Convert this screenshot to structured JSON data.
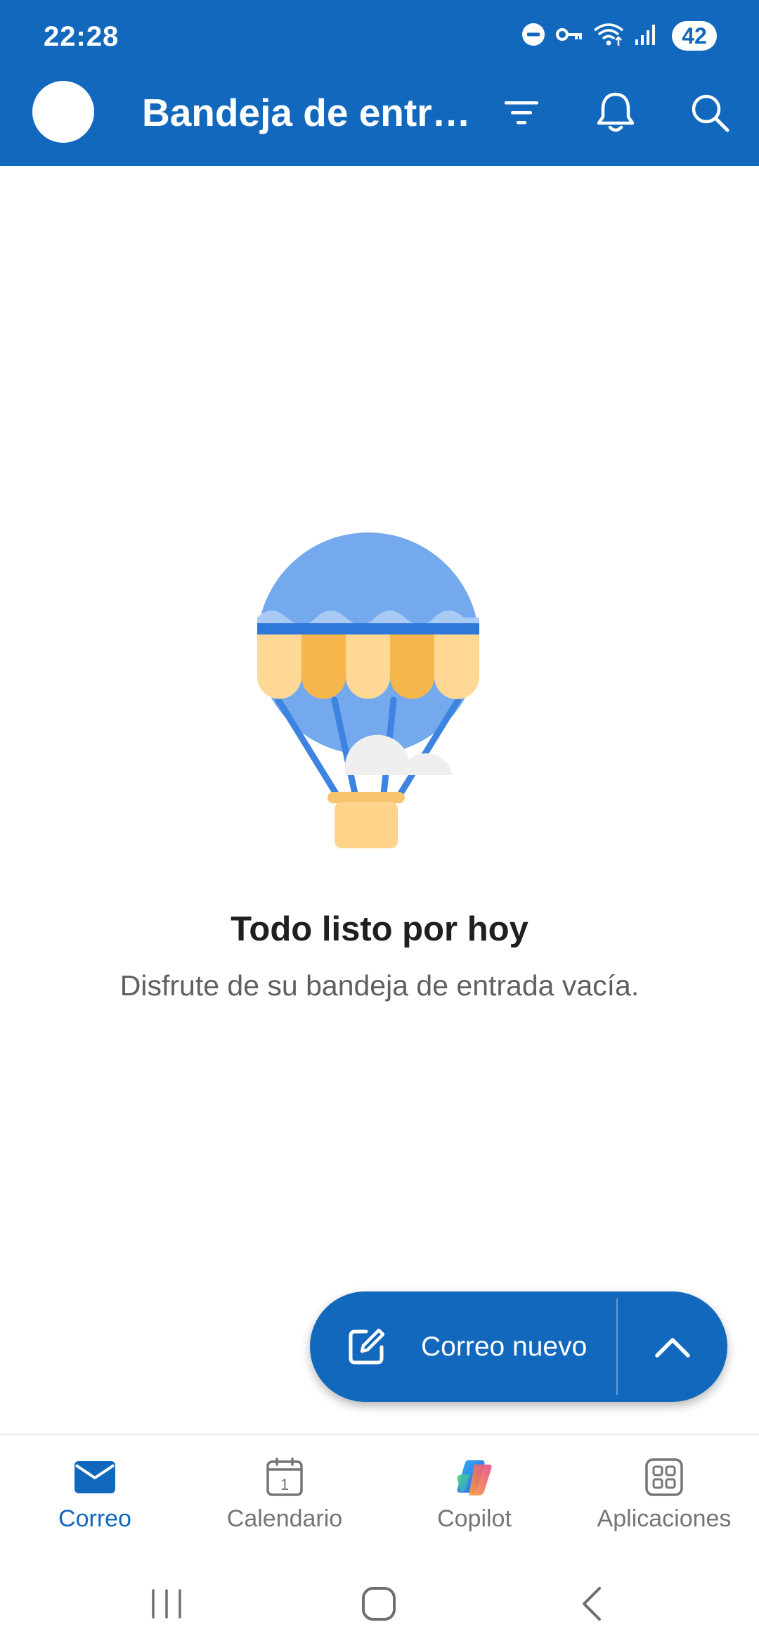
{
  "status_bar": {
    "time": "22:28",
    "battery": "42",
    "icons": [
      "do-not-disturb-icon",
      "vpn-key-icon",
      "wifi-icon",
      "signal-icon"
    ]
  },
  "app_bar": {
    "title": "Bandeja de entr…",
    "icons": [
      "filter-icon",
      "bell-icon",
      "search-icon"
    ],
    "background_color": "#1168BD"
  },
  "empty_state": {
    "title": "Todo listo por hoy",
    "subtitle": "Disfrute de su bandeja de entrada vacía."
  },
  "fab": {
    "label": "Correo nuevo",
    "icons": [
      "compose-icon",
      "chevron-up-icon"
    ]
  },
  "bottom_nav": {
    "items": [
      {
        "label": "Correo",
        "icon": "mail-icon",
        "active": true
      },
      {
        "label": "Calendario",
        "icon": "calendar-icon",
        "active": false
      },
      {
        "label": "Copilot",
        "icon": "copilot-icon",
        "active": false
      },
      {
        "label": "Aplicaciones",
        "icon": "apps-grid-icon",
        "active": false
      }
    ],
    "calendar_day": "1",
    "active_color": "#1168BD",
    "inactive_color": "#757575"
  },
  "system_nav": {
    "buttons": [
      "recents-icon",
      "home-icon",
      "back-icon"
    ]
  }
}
